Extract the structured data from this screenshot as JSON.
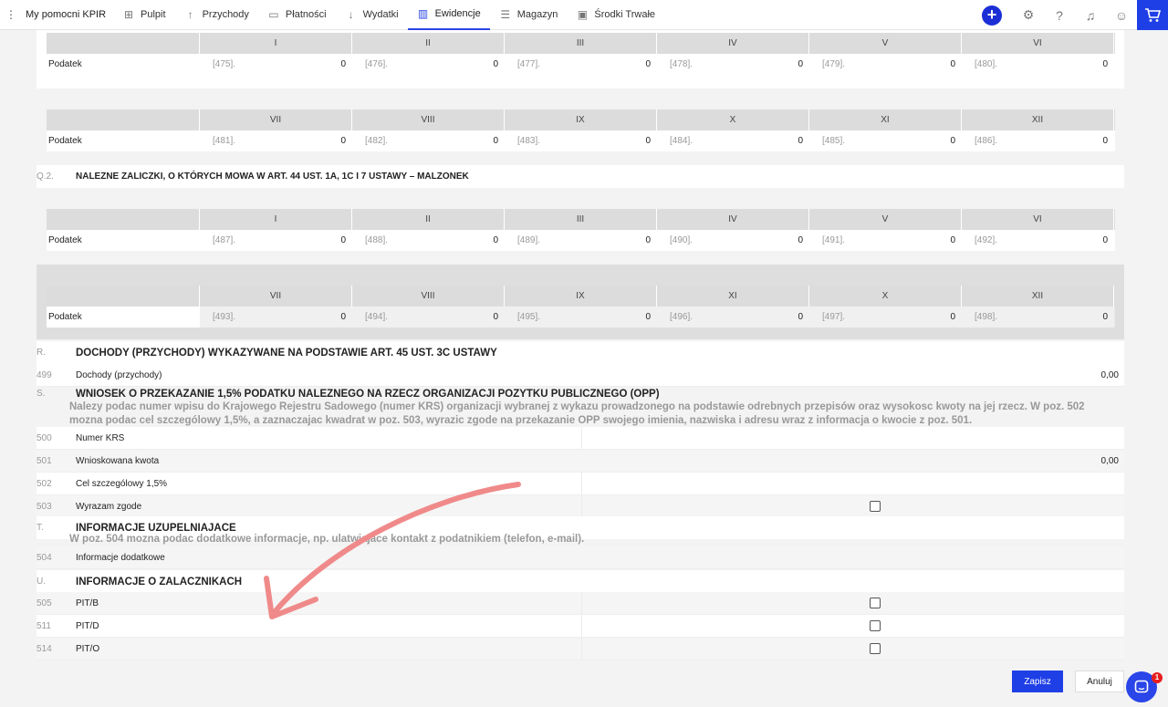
{
  "nav": {
    "brand": "My pomocni KPIR",
    "items": [
      {
        "label": "Pulpit",
        "icon": "grid-icon"
      },
      {
        "label": "Przychody",
        "icon": "arrow-up-icon"
      },
      {
        "label": "Płatności",
        "icon": "payment-icon"
      },
      {
        "label": "Wydatki",
        "icon": "arrow-down-icon"
      },
      {
        "label": "Ewidencje",
        "icon": "bar-chart-icon",
        "active": true
      },
      {
        "label": "Magazyn",
        "icon": "warehouse-icon"
      },
      {
        "label": "Środki Trwałe",
        "icon": "briefcase-icon"
      }
    ]
  },
  "colors": {
    "accent": "#1f3fe6",
    "badge": "#e81d1d",
    "arrow": "#f08a8a"
  },
  "grid1": {
    "row_label": "Podatek",
    "headers": [
      "I",
      "II",
      "III",
      "IV",
      "V",
      "VI"
    ],
    "cells": [
      {
        "code": "[475].",
        "value": "0"
      },
      {
        "code": "[476].",
        "value": "0"
      },
      {
        "code": "[477].",
        "value": "0"
      },
      {
        "code": "[478].",
        "value": "0"
      },
      {
        "code": "[479].",
        "value": "0"
      },
      {
        "code": "[480].",
        "value": "0"
      }
    ]
  },
  "grid2": {
    "row_label": "Podatek",
    "headers": [
      "VII",
      "VIII",
      "IX",
      "X",
      "XI",
      "XII"
    ],
    "cells": [
      {
        "code": "[481].",
        "value": "0"
      },
      {
        "code": "[482].",
        "value": "0"
      },
      {
        "code": "[483].",
        "value": "0"
      },
      {
        "code": "[484].",
        "value": "0"
      },
      {
        "code": "[485].",
        "value": "0"
      },
      {
        "code": "[486].",
        "value": "0"
      }
    ]
  },
  "q2": {
    "prefix": "Q.2.",
    "title": "NALEZNE ZALICZKI, O KTÓRYCH MOWA W ART. 44 UST. 1A, 1C I 7 USTAWY – MALZONEK"
  },
  "grid3": {
    "row_label": "Podatek",
    "headers": [
      "I",
      "II",
      "III",
      "IV",
      "V",
      "VI"
    ],
    "cells": [
      {
        "code": "[487].",
        "value": "0"
      },
      {
        "code": "[488].",
        "value": "0"
      },
      {
        "code": "[489].",
        "value": "0"
      },
      {
        "code": "[490].",
        "value": "0"
      },
      {
        "code": "[491].",
        "value": "0"
      },
      {
        "code": "[492].",
        "value": "0"
      }
    ]
  },
  "grid4": {
    "row_label": "Podatek",
    "headers": [
      "VII",
      "VIII",
      "IX",
      "XI",
      "X",
      "XII"
    ],
    "cells": [
      {
        "code": "[493].",
        "value": "0"
      },
      {
        "code": "[494].",
        "value": "0"
      },
      {
        "code": "[495].",
        "value": "0"
      },
      {
        "code": "[496].",
        "value": "0"
      },
      {
        "code": "[497].",
        "value": "0"
      },
      {
        "code": "[498].",
        "value": "0"
      }
    ]
  },
  "r": {
    "prefix": "R.",
    "title": "DOCHODY (PRZYCHODY) WYKAZYWANE NA PODSTAWIE ART. 45 UST. 3C USTAWY",
    "num": "499",
    "label": "Dochody (przychody)",
    "value": "0,00"
  },
  "s": {
    "prefix": "S.",
    "title": "WNIOSEK O PRZEKAZANIE 1,5% PODATKU NALEZNEGO NA RZECZ ORGANIZACJI POZYTKU PUBLICZNEGO (OPP)",
    "desc": "Nalezy podac numer wpisu do Krajowego Rejestru Sadowego (numer KRS) organizacji wybranej z wykazu prowadzonego na podstawie odrebnych przepisów oraz wysokosc kwoty na jej rzecz. W poz. 502 mozna podac cel szczególowy 1,5%, a zaznaczajac kwadrat w poz. 503, wyrazic zgode na przekazanie OPP swojego imienia, nazwiska i adresu wraz z informacja o kwocie z poz. 501.",
    "rows": [
      {
        "num": "500",
        "label": "Numer KRS"
      },
      {
        "num": "501",
        "label": "Wnioskowana kwota",
        "value": "0,00"
      },
      {
        "num": "502",
        "label": "Cel szczególowy 1,5%"
      },
      {
        "num": "503",
        "label": "Wyrazam zgode"
      }
    ]
  },
  "t": {
    "prefix": "T.",
    "title": "INFORMACJE UZUPELNIAJACE",
    "desc": "W poz. 504 mozna podac dodatkowe informacje, np. ulatwiajace kontakt z podatnikiem (telefon, e-mail).",
    "num": "504",
    "label": "Informacje dodatkowe"
  },
  "u": {
    "prefix": "U.",
    "title": "INFORMACJE O ZALACZNIKACH",
    "rows": [
      {
        "num": "505",
        "label": "PIT/B"
      },
      {
        "num": "511",
        "label": "PIT/D"
      },
      {
        "num": "514",
        "label": "PIT/O"
      }
    ]
  },
  "actions": {
    "save": "Zapisz",
    "cancel": "Anuluj"
  },
  "chat": {
    "badge": "1"
  }
}
